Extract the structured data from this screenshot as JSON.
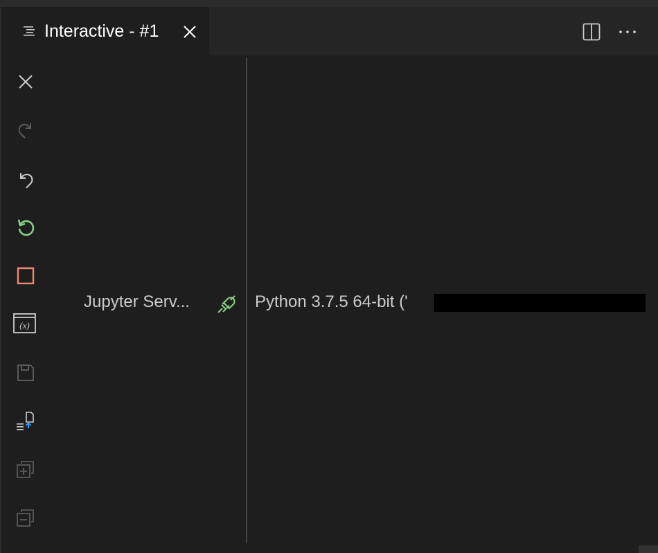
{
  "tab": {
    "label": "Interactive - #1",
    "icon": "list-icon",
    "close_icon": "close-icon"
  },
  "editor_actions": {
    "split_icon": "split-editor-icon",
    "more_icon": "more-actions-icon"
  },
  "toolbar": {
    "items": [
      {
        "name": "clear-all-icon",
        "enabled": true
      },
      {
        "name": "redo-icon",
        "enabled": false
      },
      {
        "name": "undo-icon",
        "enabled": true
      },
      {
        "name": "restart-kernel-icon",
        "enabled": true,
        "color": "#89d185"
      },
      {
        "name": "interrupt-kernel-icon",
        "enabled": true,
        "color": "#f48771"
      },
      {
        "name": "variables-icon",
        "enabled": true
      },
      {
        "name": "save-icon",
        "enabled": false
      },
      {
        "name": "export-icon",
        "enabled": true
      },
      {
        "name": "expand-all-icon",
        "enabled": false
      },
      {
        "name": "collapse-all-icon",
        "enabled": false
      }
    ]
  },
  "status": {
    "jupyter_server_label": "Jupyter Serv...",
    "connection_icon": "connected-plug-icon",
    "connection_color": "#89d185",
    "kernel_label": "Python 3.7.5 64-bit ('"
  },
  "colors": {
    "background": "#1e1e1e",
    "tab_background": "#1e1e1e",
    "tabbar_background": "#252526",
    "text": "#cccccc",
    "disabled_icon": "#5a5a5a"
  }
}
